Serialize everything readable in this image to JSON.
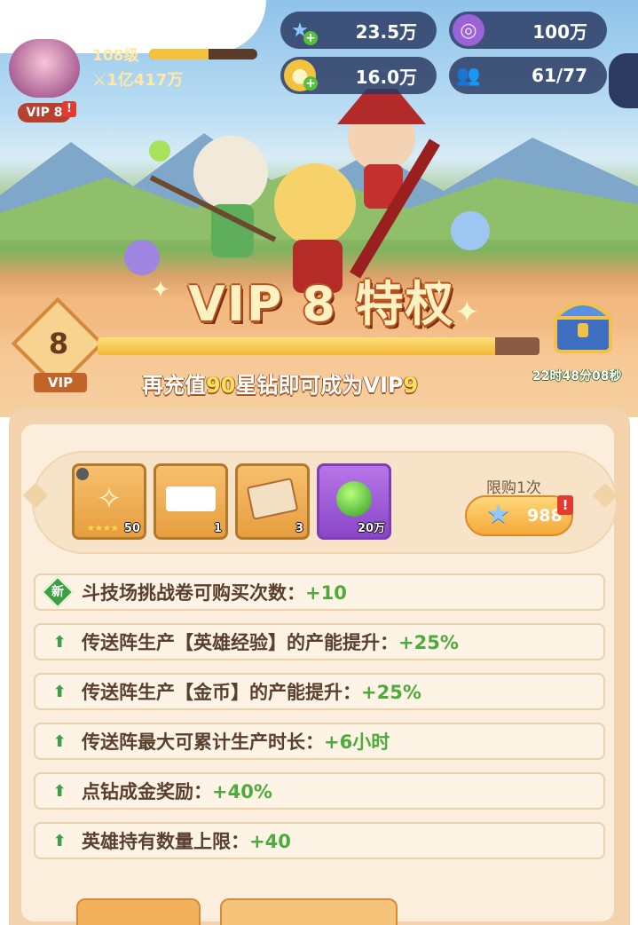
{
  "hud": {
    "star_diamond": "23.5万",
    "purple_gem": "100万",
    "gold": "16.0万",
    "friends": "61/77"
  },
  "player": {
    "level": "108级",
    "level_progress": 0.55,
    "power": "1亿417万",
    "vip_badge": "VIP 8",
    "alert": "!"
  },
  "title": "VIP 8 特权",
  "vip": {
    "level": "8",
    "tag": "VIP",
    "progress": 0.9,
    "hint_prefix": "再充值",
    "hint_amount": "90",
    "hint_mid": "星钻即可成为VIP",
    "hint_next": "9"
  },
  "timer": "22时48分08秒",
  "rewards": {
    "items": [
      {
        "icon": "hero-shard-icon",
        "count": "50"
      },
      {
        "icon": "gold-coins-icon",
        "count": "1"
      },
      {
        "icon": "ticket-icon",
        "count": "3"
      },
      {
        "icon": "green-potion-icon",
        "count": "20万"
      }
    ],
    "limit": "限购1次",
    "price": "988",
    "alert": "!"
  },
  "perks": [
    {
      "badge": "新",
      "label": "斗技场挑战卷可购买次数：",
      "value": "+10"
    },
    {
      "badge": "",
      "label": "传送阵生产【英雄经验】的产能提升：",
      "value": "+25%"
    },
    {
      "badge": "",
      "label": "传送阵生产【金币】的产能提升：",
      "value": "+25%"
    },
    {
      "badge": "",
      "label": "传送阵最大可累计生产时长：",
      "value": "+6小时"
    },
    {
      "badge": "",
      "label": "点钻成金奖励：",
      "value": "+40%"
    },
    {
      "badge": "",
      "label": "英雄持有数量上限：",
      "value": "+40"
    }
  ],
  "colors": {
    "accent": "#f4a93a",
    "value_green": "#4eaa3c",
    "hint_highlight": "#ffe05a"
  }
}
